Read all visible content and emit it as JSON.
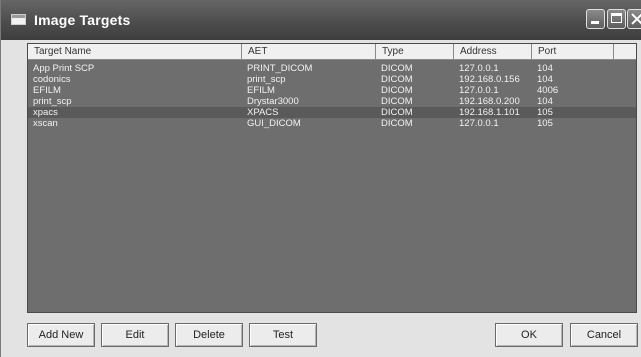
{
  "window": {
    "title": "Image Targets"
  },
  "table": {
    "columns": [
      "Target Name",
      "AET",
      "Type",
      "Address",
      "Port"
    ],
    "rows": [
      [
        "App Print SCP",
        "PRINT_DICOM",
        "DICOM",
        "127.0.0.1",
        "104"
      ],
      [
        "codonics",
        "print_scp",
        "DICOM",
        "192.168.0.156",
        "104"
      ],
      [
        "EFILM",
        "EFILM",
        "DICOM",
        "127.0.0.1",
        "4006"
      ],
      [
        "print_scp",
        "Drystar3000",
        "DICOM",
        "192.168.0.200",
        "104"
      ],
      [
        "xpacs",
        "XPACS",
        "DICOM",
        "192.168.1.101",
        "105"
      ],
      [
        "xscan",
        "GUI_DICOM",
        "DICOM",
        "127.0.0.1",
        "105"
      ]
    ],
    "selected_row": 4
  },
  "buttons": {
    "add_new": "Add New",
    "edit": "Edit",
    "delete": "Delete",
    "test": "Test",
    "ok": "OK",
    "cancel": "Cancel"
  },
  "colors": {
    "titlebar": "#4d4d4d",
    "list_background": "#6e6e6e",
    "selected_row": "#5a5a5a",
    "header_background": "#f0f0f0"
  }
}
